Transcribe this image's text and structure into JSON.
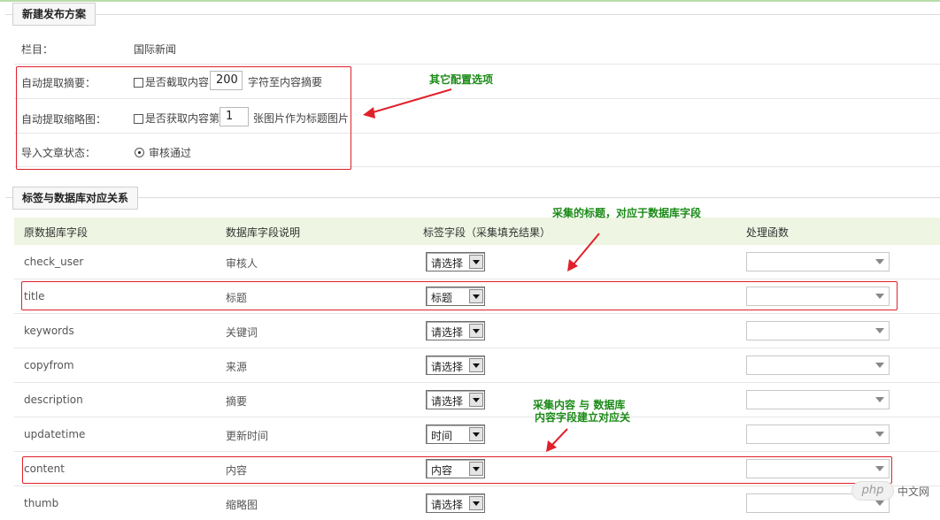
{
  "sections": {
    "publish": {
      "title": "新建发布方案"
    },
    "mapping": {
      "title": "标签与数据库对应关系"
    }
  },
  "config": {
    "column": {
      "label": "栏目：",
      "value": "国际新闻"
    },
    "auto_summary": {
      "label": "自动提取摘要：",
      "checked": false,
      "text_before": "是否截取内容",
      "value": "200",
      "text_after": "字符至内容摘要"
    },
    "auto_thumb": {
      "label": "自动提取缩略图：",
      "checked": false,
      "text_before": "是否获取内容第",
      "value": "1",
      "text_after": "张图片作为标题图片"
    },
    "import_status": {
      "label": "导入文章状态：",
      "option": "审核通过",
      "selected": true
    }
  },
  "table": {
    "headers": [
      "原数据库字段",
      "数据库字段说明",
      "标签字段（采集填充结果）",
      "处理函数"
    ],
    "rows": [
      {
        "field": "check_user",
        "desc": "审核人",
        "tag": "请选择"
      },
      {
        "field": "title",
        "desc": "标题",
        "tag": "标题"
      },
      {
        "field": "keywords",
        "desc": "关键词",
        "tag": "请选择"
      },
      {
        "field": "copyfrom",
        "desc": "来源",
        "tag": "请选择"
      },
      {
        "field": "description",
        "desc": "摘要",
        "tag": "请选择"
      },
      {
        "field": "updatetime",
        "desc": "更新时间",
        "tag": "时间"
      },
      {
        "field": "content",
        "desc": "内容",
        "tag": "内容"
      },
      {
        "field": "thumb",
        "desc": "缩略图",
        "tag": "请选择"
      }
    ]
  },
  "annotations": {
    "other_options": "其它配置选项",
    "title_note": "采集的标题，对应于数据库字段",
    "content_note_line1": "采集内容 与  数据库",
    "content_note_line2": "内容字段建立对应关"
  },
  "watermark": {
    "logo": "php",
    "text": "中文网"
  },
  "colors": {
    "annotation_red": "#e0202a",
    "annotation_green": "#1a8a16",
    "header_bg": "#eef5e2"
  }
}
